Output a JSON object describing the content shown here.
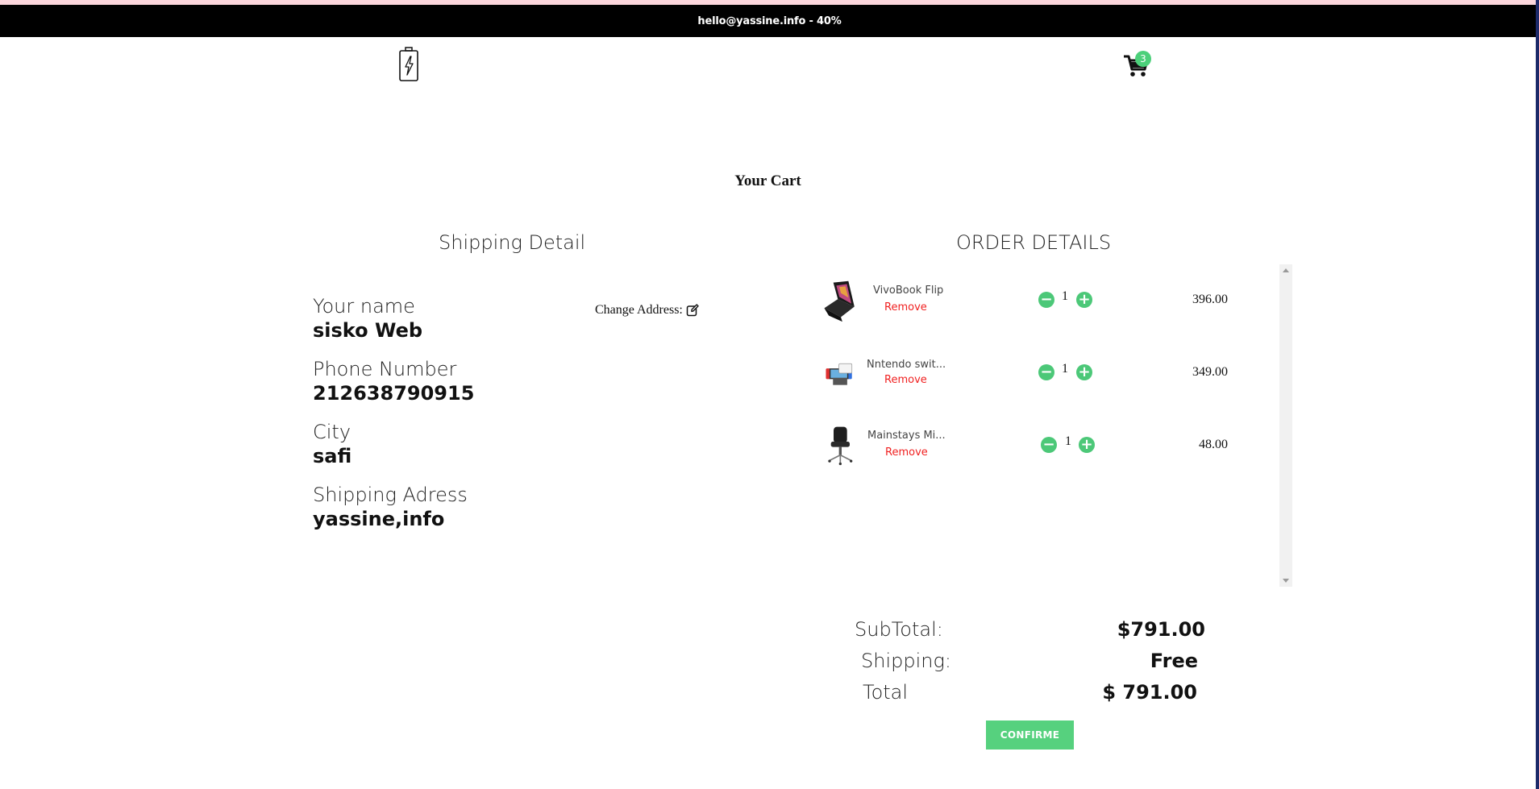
{
  "topbar": {
    "text": "hello@yassine.info - 40%"
  },
  "header": {
    "logo_icon": "battery-icon",
    "cart_icon": "cart-icon",
    "cart_count": "3"
  },
  "page": {
    "title": "Your Cart"
  },
  "shipping": {
    "title": "Shipping Detail",
    "change_address": "Change Address:",
    "fields": [
      {
        "label": "Your name",
        "value": "sisko Web"
      },
      {
        "label": "Phone Number",
        "value": "212638790915"
      },
      {
        "label": "City",
        "value": "safi"
      },
      {
        "label": "Shipping Adress",
        "value": "yassine,info"
      }
    ]
  },
  "order": {
    "title": "ORDER DETAILS",
    "items": [
      {
        "name": "VivoBook Flip",
        "remove": "Remove",
        "qty": "1",
        "price": "396.00",
        "minus": "−",
        "plus": "+"
      },
      {
        "name": "Nntendo swit...",
        "remove": "Remove",
        "qty": "1",
        "price": "349.00",
        "minus": "−",
        "plus": "+"
      },
      {
        "name": "Mainstays Mi...",
        "remove": "Remove",
        "qty": "1",
        "price": "48.00",
        "minus": "−",
        "plus": "+"
      }
    ]
  },
  "summary": {
    "subtotal_label": "SubTotal:",
    "subtotal_value": "$791.00",
    "shipping_label": "Shipping:",
    "shipping_value": "Free",
    "total_label": "Total",
    "total_value": "$ 791.00"
  },
  "actions": {
    "confirm": "CONFIRME"
  },
  "colors": {
    "accent": "#56d17e",
    "remove": "#f02020",
    "topbar": "#000000"
  }
}
